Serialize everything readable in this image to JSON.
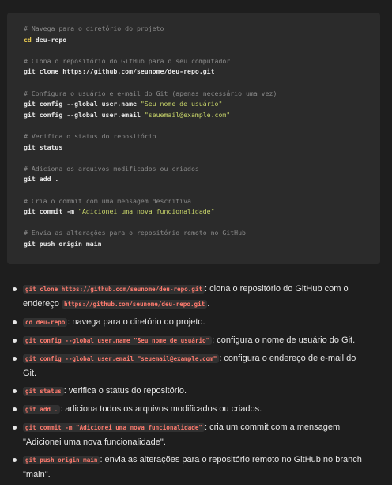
{
  "code": {
    "lines": [
      {
        "type": "comment",
        "text": "# Navega para o diretório do projeto"
      },
      {
        "type": "cmd",
        "kw": "cd",
        "rest": " deu-repo"
      },
      {
        "type": "blank"
      },
      {
        "type": "comment",
        "text": "# Clona o repositório do GitHub para o seu computador"
      },
      {
        "type": "cmd",
        "kw": "",
        "rest": "git clone https://github.com/seunome/deu-repo.git"
      },
      {
        "type": "blank"
      },
      {
        "type": "comment",
        "text": "# Configura o usuário e e-mail do Git (apenas necessário uma vez)"
      },
      {
        "type": "cmdstr",
        "rest": "git config --global user.name ",
        "str": "\"Seu nome de usuário\""
      },
      {
        "type": "cmdstr",
        "rest": "git config --global user.email ",
        "str": "\"seuemail@example.com\""
      },
      {
        "type": "blank"
      },
      {
        "type": "comment",
        "text": "# Verifica o status do repositório"
      },
      {
        "type": "cmd",
        "kw": "",
        "rest": "git status"
      },
      {
        "type": "blank"
      },
      {
        "type": "comment",
        "text": "# Adiciona os arquivos modificados ou criados"
      },
      {
        "type": "cmd",
        "kw": "",
        "rest": "git add ."
      },
      {
        "type": "blank"
      },
      {
        "type": "comment",
        "text": "# Cria o commit com uma mensagem descritiva"
      },
      {
        "type": "cmdstr",
        "rest": "git commit -m ",
        "str": "\"Adicionei uma nova funcionalidade\""
      },
      {
        "type": "blank"
      },
      {
        "type": "comment",
        "text": "# Envia as alterações para o repositório remoto no GitHub"
      },
      {
        "type": "cmd",
        "kw": "",
        "rest": "git push origin main"
      }
    ]
  },
  "explanations": [
    {
      "parts": [
        {
          "code": "git clone https://github.com/seunome/deu-repo.git"
        },
        {
          "text": ": clona o repositório do GitHub com o endereço "
        },
        {
          "code": "https://github.com/seunome/deu-repo.git"
        },
        {
          "text": "."
        }
      ]
    },
    {
      "parts": [
        {
          "code": "cd deu-repo"
        },
        {
          "text": ": navega para o diretório do projeto."
        }
      ]
    },
    {
      "parts": [
        {
          "code": "git config --global user.name \"Seu nome de usuário\""
        },
        {
          "text": ": configura o nome de usuário do Git."
        }
      ]
    },
    {
      "parts": [
        {
          "code": "git config --global user.email \"seuemail@example.com\""
        },
        {
          "text": ": configura o endereço de e-mail do Git."
        }
      ]
    },
    {
      "parts": [
        {
          "code": "git status"
        },
        {
          "text": ": verifica o status do repositório."
        }
      ]
    },
    {
      "parts": [
        {
          "code": "git add ."
        },
        {
          "text": ": adiciona todos os arquivos modificados ou criados."
        }
      ]
    },
    {
      "parts": [
        {
          "code": "git commit -m \"Adicionei uma nova funcionalidade\""
        },
        {
          "text": ": cria um commit com a mensagem \"Adicionei uma nova funcionalidade\"."
        }
      ]
    },
    {
      "parts": [
        {
          "code": "git push origin main"
        },
        {
          "text": ": envia as alterações para o repositório remoto no GitHub no branch \"main\"."
        }
      ]
    }
  ]
}
